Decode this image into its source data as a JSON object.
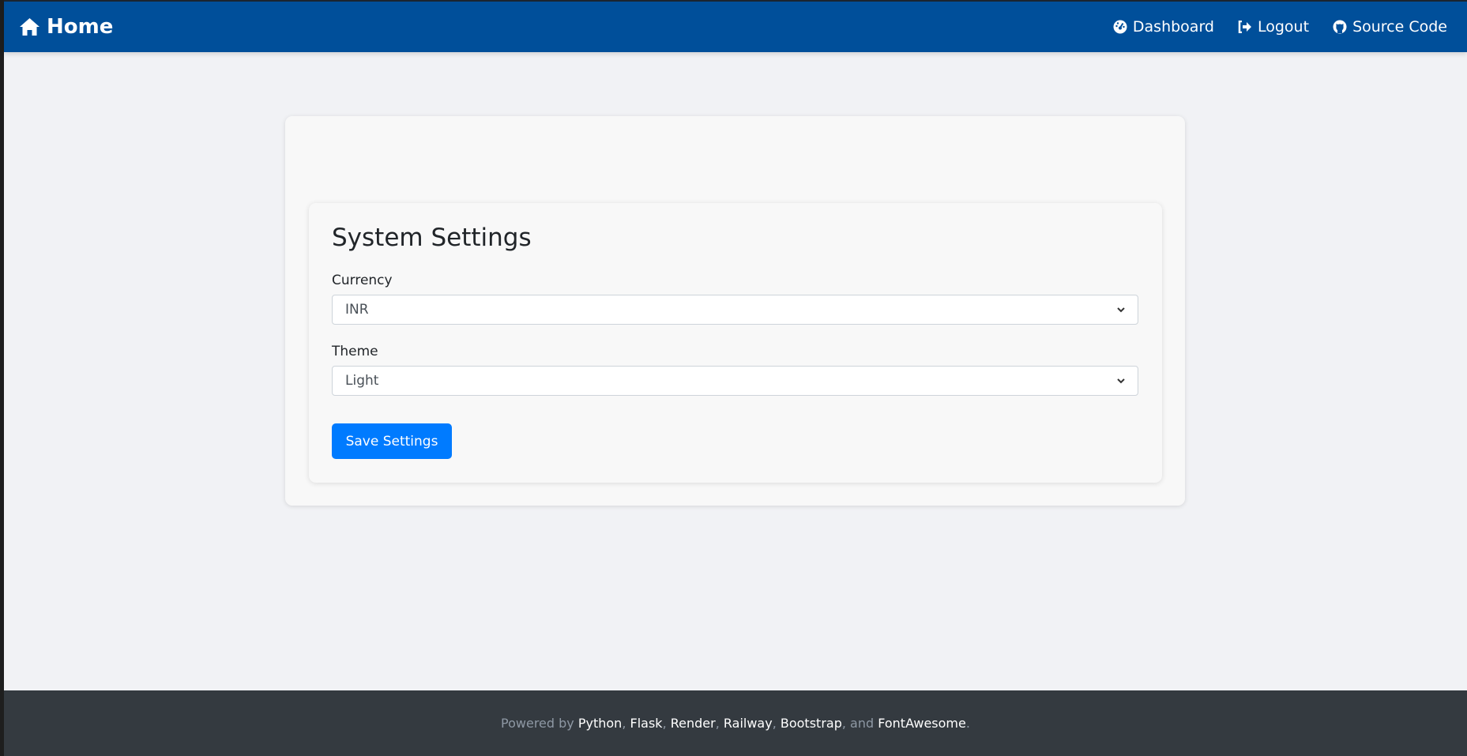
{
  "navbar": {
    "brand": "Home",
    "links": [
      {
        "label": "Dashboard",
        "icon": "dashboard-gauge-icon"
      },
      {
        "label": "Logout",
        "icon": "logout-icon"
      },
      {
        "label": "Source Code",
        "icon": "github-icon"
      }
    ],
    "color": "#004f9a"
  },
  "settings": {
    "title": "System Settings",
    "currency_label": "Currency",
    "currency_value": "INR",
    "theme_label": "Theme",
    "theme_value": "Light",
    "save_label": "Save Settings",
    "button_color": "#007bff"
  },
  "footer": {
    "prefix": "Powered by",
    "techs": [
      "Python",
      "Flask",
      "Render",
      "Railway",
      "Bootstrap"
    ],
    "and": "and",
    "last": "FontAwesome"
  }
}
